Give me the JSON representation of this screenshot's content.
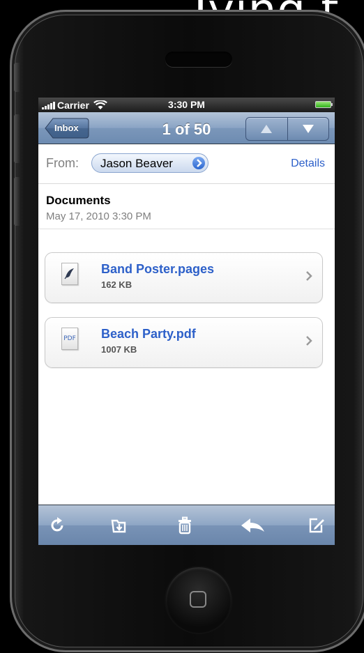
{
  "banner": {
    "text": "Tying t"
  },
  "status_bar": {
    "carrier": "Carrier",
    "time": "3:30 PM"
  },
  "nav": {
    "back_label": "Inbox",
    "title": "1 of 50",
    "up_icon": "triangle-up-icon",
    "down_icon": "triangle-down-icon"
  },
  "message": {
    "from_label": "From:",
    "sender": "Jason Beaver",
    "details_label": "Details",
    "subject": "Documents",
    "date": "May 17, 2010 3:30 PM"
  },
  "attachments": [
    {
      "name": "Band Poster.pages",
      "size": "162 KB",
      "icon": "pages-document-icon"
    },
    {
      "name": "Beach Party.pdf",
      "size": "1007 KB",
      "icon": "pdf-document-icon",
      "icon_text": "PDF"
    }
  ],
  "toolbar": {
    "items": [
      "refresh-icon",
      "move-to-folder-icon",
      "trash-icon",
      "reply-icon",
      "compose-icon"
    ]
  },
  "colors": {
    "nav_blue": "#7b97ba",
    "link_blue": "#2d60c9",
    "battery_green": "#2fb21a"
  }
}
